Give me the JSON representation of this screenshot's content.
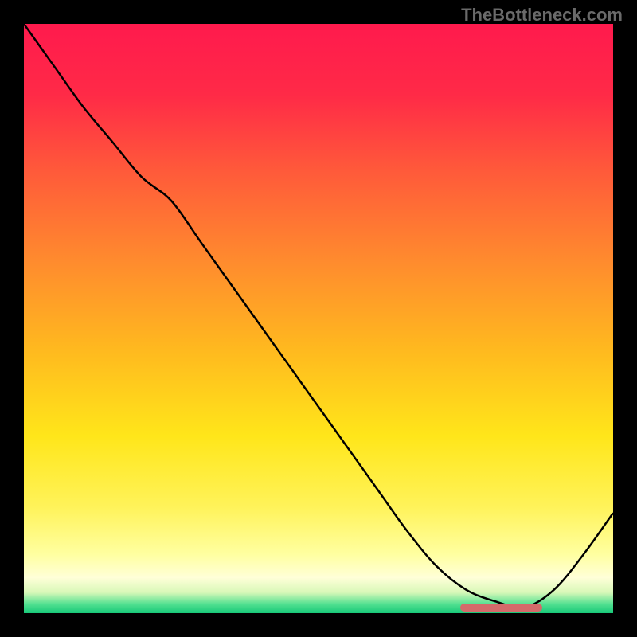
{
  "watermark": "TheBottleneck.com",
  "chart_data": {
    "type": "line",
    "title": "",
    "xlabel": "",
    "ylabel": "",
    "xlim": [
      0,
      100
    ],
    "ylim": [
      0,
      100
    ],
    "x": [
      0,
      5,
      10,
      15,
      20,
      25,
      30,
      35,
      40,
      45,
      50,
      55,
      60,
      65,
      70,
      75,
      80,
      85,
      90,
      95,
      100
    ],
    "values": [
      100,
      93,
      86,
      80,
      74,
      70,
      63,
      56,
      49,
      42,
      35,
      28,
      21,
      14,
      8,
      4,
      2,
      1,
      4,
      10,
      17
    ],
    "gradient_stops": [
      {
        "pos": 0.0,
        "color": "#ff1a4d"
      },
      {
        "pos": 0.12,
        "color": "#ff2a47"
      },
      {
        "pos": 0.25,
        "color": "#ff5a3a"
      },
      {
        "pos": 0.4,
        "color": "#ff8a2e"
      },
      {
        "pos": 0.55,
        "color": "#ffb81f"
      },
      {
        "pos": 0.7,
        "color": "#ffe61a"
      },
      {
        "pos": 0.82,
        "color": "#fff35a"
      },
      {
        "pos": 0.9,
        "color": "#ffffa0"
      },
      {
        "pos": 0.94,
        "color": "#ffffd8"
      },
      {
        "pos": 0.965,
        "color": "#d8f8b8"
      },
      {
        "pos": 0.985,
        "color": "#50e090"
      },
      {
        "pos": 1.0,
        "color": "#18c878"
      }
    ],
    "optimal_marker": {
      "x_start": 74,
      "x_end": 88,
      "y": 1
    }
  }
}
